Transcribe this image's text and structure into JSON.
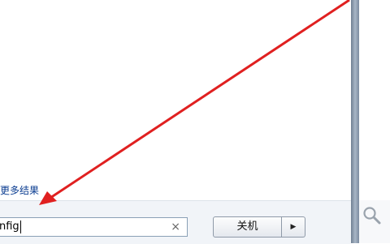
{
  "start_menu": {
    "more_results_label": "更多结果",
    "search_value": "nfig",
    "clear_icon": "×"
  },
  "shutdown": {
    "label": "关机",
    "arrow": "▶"
  },
  "right_panel": {
    "icon": "search-icon"
  },
  "colors": {
    "annotation_arrow": "#e02020",
    "link_text": "#0b3d91"
  }
}
